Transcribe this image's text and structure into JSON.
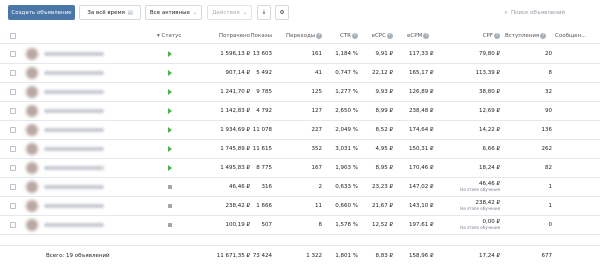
{
  "toolbar": {
    "create_label": "Создать объявление",
    "period_label": "За всё время",
    "status_label": "Все активные",
    "actions_label": "Действия",
    "download_glyph": "⤓",
    "settings_glyph": "⚙",
    "search_placeholder": "Поиск объявлений"
  },
  "columns": {
    "status": "Статус",
    "spent": "Потрачено",
    "impressions": "Показы",
    "clicks": "Переходы",
    "ctr": "CTR",
    "ecpc": "eCPC",
    "ecpm": "eCPM",
    "cpf": "CPF",
    "joins": "Вступления",
    "messages": "Сообщен..."
  },
  "rows": [
    {
      "status": "running",
      "spent": "1 596,13 ₽",
      "impressions": "13 603",
      "clicks": "161",
      "ctr": "1,184 %",
      "ecpc": "9,91 ₽",
      "ecpm": "117,33 ₽",
      "cpf": "79,80 ₽",
      "cpf_note": "",
      "joins": "20"
    },
    {
      "status": "running",
      "spent": "907,14 ₽",
      "impressions": "5 492",
      "clicks": "41",
      "ctr": "0,747 %",
      "ecpc": "22,12 ₽",
      "ecpm": "165,17 ₽",
      "cpf": "113,39 ₽",
      "cpf_note": "",
      "joins": "8"
    },
    {
      "status": "running",
      "spent": "1 241,70 ₽",
      "impressions": "9 785",
      "clicks": "125",
      "ctr": "1,277 %",
      "ecpc": "9,93 ₽",
      "ecpm": "126,89 ₽",
      "cpf": "38,80 ₽",
      "cpf_note": "",
      "joins": "32"
    },
    {
      "status": "running",
      "spent": "1 142,83 ₽",
      "impressions": "4 792",
      "clicks": "127",
      "ctr": "2,650 %",
      "ecpc": "8,99 ₽",
      "ecpm": "238,48 ₽",
      "cpf": "12,69 ₽",
      "cpf_note": "",
      "joins": "90"
    },
    {
      "status": "running",
      "spent": "1 934,69 ₽",
      "impressions": "11 078",
      "clicks": "227",
      "ctr": "2,049 %",
      "ecpc": "8,52 ₽",
      "ecpm": "174,64 ₽",
      "cpf": "14,22 ₽",
      "cpf_note": "",
      "joins": "136"
    },
    {
      "status": "running",
      "spent": "1 745,89 ₽",
      "impressions": "11 615",
      "clicks": "352",
      "ctr": "3,031 %",
      "ecpc": "4,95 ₽",
      "ecpm": "150,31 ₽",
      "cpf": "6,66 ₽",
      "cpf_note": "",
      "joins": "262"
    },
    {
      "status": "running",
      "spent": "1 495,83 ₽",
      "impressions": "8 775",
      "clicks": "167",
      "ctr": "1,903 %",
      "ecpc": "8,95 ₽",
      "ecpm": "170,46 ₽",
      "cpf": "18,24 ₽",
      "cpf_note": "",
      "joins": "82"
    },
    {
      "status": "stopped",
      "spent": "46,46 ₽",
      "impressions": "316",
      "clicks": "2",
      "ctr": "0,633 %",
      "ecpc": "23,23 ₽",
      "ecpm": "147,02 ₽",
      "cpf": "46,46 ₽",
      "cpf_note": "На этапе обучения",
      "joins": "1"
    },
    {
      "status": "stopped",
      "spent": "238,42 ₽",
      "impressions": "1 666",
      "clicks": "11",
      "ctr": "0,660 %",
      "ecpc": "21,67 ₽",
      "ecpm": "143,10 ₽",
      "cpf": "238,42 ₽",
      "cpf_note": "На этапе обучения",
      "joins": "1"
    },
    {
      "status": "stopped",
      "spent": "100,19 ₽",
      "impressions": "507",
      "clicks": "8",
      "ctr": "1,578 %",
      "ecpc": "12,52 ₽",
      "ecpm": "197,61 ₽",
      "cpf": "0,00 ₽",
      "cpf_note": "На этапе обучения",
      "joins": "0"
    }
  ],
  "footer": {
    "total_label": "Всего: 19 объявлений",
    "spent": "11 671,35 ₽",
    "impressions": "73 424",
    "clicks": "1 322",
    "ctr": "1,801 %",
    "ecpc": "8,83 ₽",
    "ecpm": "158,96 ₽",
    "cpf": "17,24 ₽",
    "joins": "677"
  },
  "colors": {
    "primary": "#4a76a8",
    "running": "#4bb34b",
    "stopped": "#a0a7af",
    "help": "#a8b1ba"
  }
}
